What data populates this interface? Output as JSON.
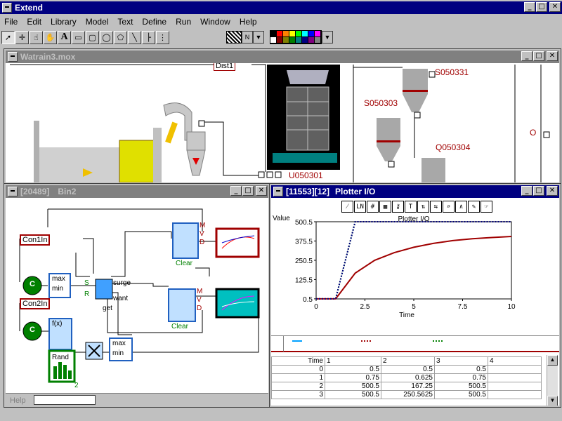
{
  "app": {
    "title": "Extend"
  },
  "menu": [
    "File",
    "Edit",
    "Library",
    "Model",
    "Text",
    "Define",
    "Run",
    "Window",
    "Help"
  ],
  "toolbar": {
    "tools": [
      "arrow-icon",
      "cursor-plus-icon",
      "hand-pointer-icon",
      "hand-icon",
      "text-icon",
      "rectangle-icon",
      "rounded-rect-icon",
      "oval-icon",
      "polygon-icon",
      "line-icon",
      "connector-icon",
      "hierarchy-icon"
    ],
    "colors": [
      "#000000",
      "#ff0000",
      "#ff8000",
      "#ffff00",
      "#00ff00",
      "#00ffff",
      "#0000ff",
      "#ff00ff",
      "#ffffff",
      "#800000",
      "#808000",
      "#008000",
      "#008080",
      "#000080",
      "#800080",
      "#808080"
    ],
    "pattern_label": "N"
  },
  "model_window": {
    "title": "Watrain3.mox",
    "labels": {
      "dist": "Dist1",
      "s1": "S050331",
      "s2": "S050303",
      "q": "Q050304",
      "u": "U050301",
      "o": "O"
    }
  },
  "bin_window": {
    "title_id": "[20489]",
    "title_name": "Bin2",
    "inputs": [
      "Con1In",
      "Con2In"
    ],
    "block_labels": {
      "c": "C",
      "max": "max",
      "min": "min",
      "fx": "f(x)",
      "rand": "Rand",
      "surge": "surge",
      "want": "want",
      "get": "get",
      "s": "S",
      "r": "R",
      "clear": "Clear",
      "m": "M",
      "v": "V",
      "d": "D",
      "two": "2"
    },
    "status": {
      "help": "Help"
    }
  },
  "plotter_window": {
    "title_id": "[11553][12]",
    "title_name": "Plotter I/O",
    "ylabel": "Value",
    "tools": [
      "LN",
      "grid",
      "key",
      "T",
      "zoom",
      "pen"
    ],
    "table": {
      "header": [
        "Time",
        "1",
        "2",
        "3",
        "4"
      ],
      "rows": [
        [
          "0",
          "0.5",
          "0.5",
          "0.5"
        ],
        [
          "1",
          "0.75",
          "0.625",
          "0.75"
        ],
        [
          "2",
          "500.5",
          "167.25",
          "500.5"
        ],
        [
          "3",
          "500.5",
          "250.5625",
          "500.5"
        ]
      ]
    }
  },
  "chart_data": {
    "type": "line",
    "title": "Plotter I/O",
    "xlabel": "Time",
    "ylabel": "Value",
    "xlim": [
      0,
      10
    ],
    "ylim": [
      0,
      500.5
    ],
    "x_ticks": [
      "0",
      "2.5",
      "5",
      "7.5",
      "10"
    ],
    "y_ticks": [
      "0.5",
      "125.5",
      "250.5",
      "375.5",
      "500.5"
    ],
    "series": [
      {
        "color": "#008000",
        "style": "dotted",
        "x": [
          0,
          1,
          1.5,
          2,
          10
        ],
        "y": [
          0.5,
          0.75,
          250,
          500.5,
          500.5
        ]
      },
      {
        "color": "#a00000",
        "style": "solid",
        "x": [
          0,
          1,
          2,
          3,
          4,
          5,
          6,
          7,
          8,
          9,
          10
        ],
        "y": [
          0.5,
          0.625,
          167.25,
          250.56,
          300,
          335,
          360,
          378,
          390,
          398,
          405
        ]
      },
      {
        "color": "#000080",
        "style": "dotted",
        "x": [
          0,
          1,
          2,
          10
        ],
        "y": [
          0.5,
          0.75,
          500.5,
          500.5
        ]
      }
    ]
  }
}
